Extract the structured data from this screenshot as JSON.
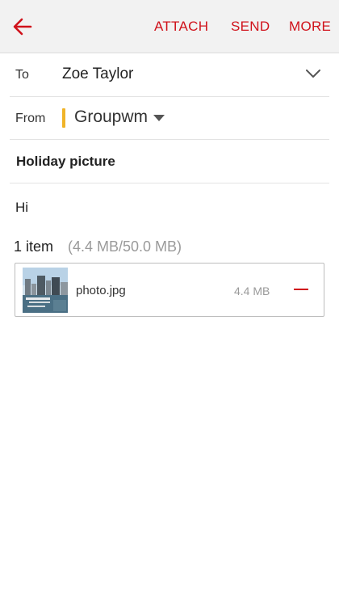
{
  "toolbar": {
    "back_icon": "arrow-left-icon",
    "actions": [
      "ATTACH",
      "SEND",
      "MORE"
    ],
    "accent_color": "#d0121b"
  },
  "compose": {
    "to_label": "To",
    "to_value": "Zoe Taylor",
    "from_label": "From",
    "from_account": "Groupwm",
    "account_color": "#f0b429",
    "subject": "Holiday picture",
    "body": "Hi"
  },
  "attachments": {
    "count_label": "1 item",
    "size_summary": "(4.4 MB/50.0 MB)",
    "items": [
      {
        "name": "photo.jpg",
        "size": "4.4 MB",
        "remove_icon": "minus-icon"
      }
    ]
  }
}
